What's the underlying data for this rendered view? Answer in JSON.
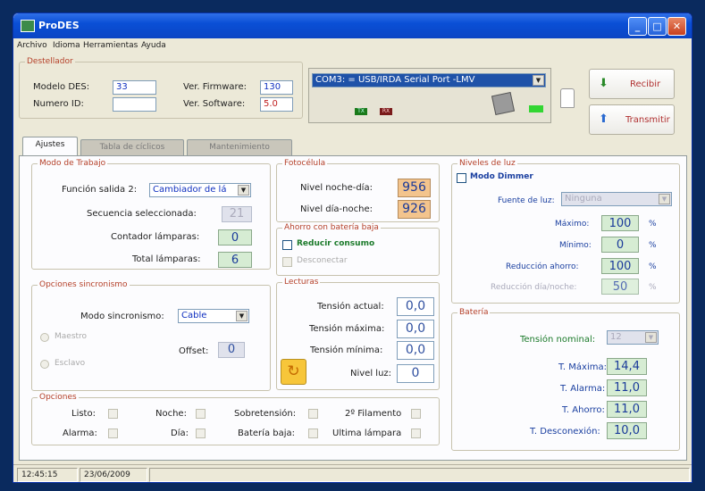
{
  "window": {
    "title": "ProDES"
  },
  "menu": [
    "Archivo",
    "Idioma",
    "Herramientas",
    "Ayuda"
  ],
  "destellador": {
    "title": "Destellador",
    "modelo_label": "Modelo DES:",
    "modelo_value": "33",
    "numero_label": "Numero ID:",
    "numero_value": "",
    "firmware_label": "Ver. Firmware:",
    "firmware_value": "130",
    "software_label": "Ver. Software:",
    "software_value": "5.0"
  },
  "port": {
    "selected": "COM3: = USB/IRDA Serial Port -LMV",
    "tx": "TX",
    "rx": "RX"
  },
  "actions": {
    "recibir": "Recibir",
    "transmitir": "Transmitir"
  },
  "tabs": [
    "Ajustes",
    "Tabla de cíclicos",
    "Mantenimiento"
  ],
  "modo_trabajo": {
    "title": "Modo de Trabajo",
    "funcion_label": "Función salida 2:",
    "funcion_value": "Cambiador de lá",
    "secuencia_label": "Secuencia seleccionada:",
    "secuencia_value": "21",
    "contador_label": "Contador lámparas:",
    "contador_value": "0",
    "total_label": "Total lámparas:",
    "total_value": "6"
  },
  "fotocelula": {
    "title": "Fotocélula",
    "noche_dia_label": "Nivel noche-día:",
    "noche_dia_value": "956",
    "dia_noche_label": "Nivel día-noche:",
    "dia_noche_value": "926"
  },
  "ahorro": {
    "title": "Ahorro con batería baja",
    "reducir": "Reducir consumo",
    "desconectar": "Desconectar"
  },
  "sincronismo": {
    "title": "Opciones sincronismo",
    "modo_label": "Modo sincronismo:",
    "modo_value": "Cable",
    "maestro": "Maestro",
    "esclavo": "Esclavo",
    "offset_label": "Offset:",
    "offset_value": "0"
  },
  "lecturas": {
    "title": "Lecturas",
    "actual_label": "Tensión actual:",
    "actual_value": "0,0",
    "maxima_label": "Tensión máxima:",
    "maxima_value": "0,0",
    "minima_label": "Tensión mínima:",
    "minima_value": "0,0",
    "nivel_label": "Nivel luz:",
    "nivel_value": "0"
  },
  "opciones": {
    "title": "Opciones",
    "items": [
      "Listo:",
      "Noche:",
      "Sobretensión:",
      "2º Filamento",
      "Alarma:",
      "Día:",
      "Batería baja:",
      "Ultima lámpara"
    ]
  },
  "niveles": {
    "title": "Niveles de luz",
    "dimmer": "Modo Dimmer",
    "fuente_label": "Fuente de luz:",
    "fuente_value": "Ninguna",
    "maximo_label": "Máximo:",
    "maximo_value": "100",
    "minimo_label": "Mínimo:",
    "minimo_value": "0",
    "reduccion_label": "Reducción ahorro:",
    "reduccion_value": "100",
    "reduccion_dn_label": "Reducción día/noche:",
    "reduccion_dn_value": "50",
    "unit": "%"
  },
  "bateria": {
    "title": "Batería",
    "nominal_label": "Tensión nominal:",
    "nominal_value": "12",
    "maxima_label": "T. Máxima:",
    "maxima_value": "14,4",
    "alarma_label": "T. Alarma:",
    "alarma_value": "11,0",
    "ahorro_label": "T. Ahorro:",
    "ahorro_value": "11,0",
    "desconexion_label": "T. Desconexión:",
    "desconexion_value": "10,0"
  },
  "status": {
    "time": "12:45:15",
    "date": "23/06/2009"
  }
}
